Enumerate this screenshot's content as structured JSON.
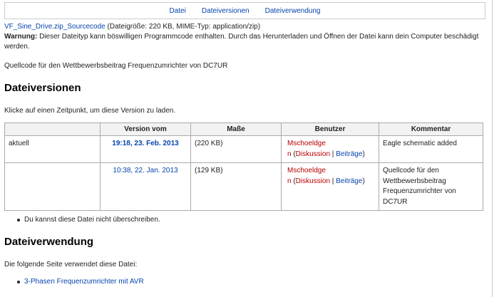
{
  "filetoc": [
    "Datei",
    "Dateiversionen",
    "Dateiverwendung"
  ],
  "file": {
    "name": "VF_Sine_Drive.zip_Sourcecode",
    "info": " (Dateigröße: 220 KB, MIME-Typ: application/zip)",
    "warning_label": "Warnung:",
    "warning_text": " Dieser Dateityp kann böswilligen Programmcode enthalten. Durch das Herunterladen und Öffnen der Datei kann dein Computer beschädigt werden.",
    "description": "Quellcode für den Wettbewerbsbeitrag Frequenzumrichter von DC7UR"
  },
  "versions": {
    "heading": "Dateiversionen",
    "instruction": "Klicke auf einen Zeitpunkt, um diese Version zu laden.",
    "columns": [
      "",
      "Version vom",
      "Maße",
      "Benutzer",
      "Kommentar"
    ],
    "rows": [
      {
        "status": "aktuell",
        "date": "19:18, 23. Feb. 2013",
        "size": "(220 KB)",
        "user_part1": "Mschoeldge",
        "user_part2": "n",
        "talk": "Diskussion",
        "contribs": "Beiträge",
        "comment": "Eagle schematic added"
      },
      {
        "status": "",
        "date": "10:38, 22. Jan. 2013",
        "size": "(129 KB)",
        "user_part1": "Mschoeldge",
        "user_part2": "n",
        "talk": "Diskussion",
        "contribs": "Beiträge",
        "comment": "Quellcode für den Wettbewerbsbeitrag Frequenzumrichter von DC7UR"
      }
    ],
    "note": "Du kannst diese Datei nicht überschreiben."
  },
  "usage": {
    "heading": "Dateiverwendung",
    "intro": "Die folgende Seite verwendet diese Datei:",
    "pages": [
      "3-Phasen Frequenzumrichter mit AVR"
    ]
  }
}
